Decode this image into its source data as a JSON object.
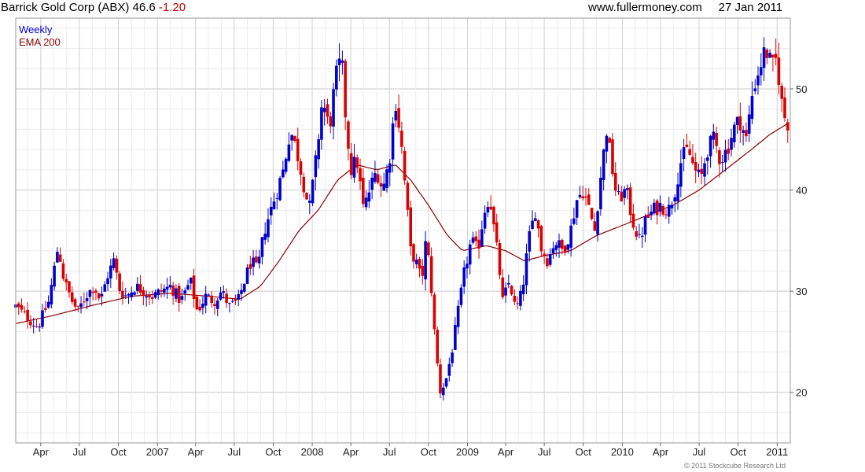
{
  "header": {
    "title": "Barrick Gold Corp (ABX)",
    "last": "46.6",
    "change": "-1.20",
    "site": "www.fullermoney.com",
    "date": "27 Jan 2011"
  },
  "colors": {
    "up": "#0000cc",
    "down": "#dd0000",
    "ema": "#8b0000",
    "grid": "#dedede",
    "border": "#999999"
  },
  "copyright": "© 2011 Stockcube Research Ltd",
  "chart_data": {
    "type": "candlestick",
    "title": "Barrick Gold Corp (ABX) 46.6 -1.20",
    "interval": "Weekly",
    "ylim": [
      15,
      57
    ],
    "yticks": [
      20,
      30,
      40,
      50
    ],
    "grid": true,
    "legend_position": "top-left",
    "legend": [
      "Weekly",
      "EMA 200"
    ],
    "xticks": [
      {
        "label": "Apr",
        "date": "2006-04-01"
      },
      {
        "label": "Jul",
        "date": "2006-07-01"
      },
      {
        "label": "Oct",
        "date": "2006-10-01"
      },
      {
        "label": "2007",
        "date": "2007-01-01"
      },
      {
        "label": "Apr",
        "date": "2007-04-01"
      },
      {
        "label": "Jul",
        "date": "2007-07-01"
      },
      {
        "label": "Oct",
        "date": "2007-10-01"
      },
      {
        "label": "2008",
        "date": "2008-01-01"
      },
      {
        "label": "Apr",
        "date": "2008-04-01"
      },
      {
        "label": "Jul",
        "date": "2008-07-01"
      },
      {
        "label": "Oct",
        "date": "2008-10-01"
      },
      {
        "label": "2009",
        "date": "2009-01-01"
      },
      {
        "label": "Apr",
        "date": "2009-04-01"
      },
      {
        "label": "Jul",
        "date": "2009-07-01"
      },
      {
        "label": "Oct",
        "date": "2009-10-01"
      },
      {
        "label": "2010",
        "date": "2010-01-01"
      },
      {
        "label": "Apr",
        "date": "2010-04-01"
      },
      {
        "label": "Jul",
        "date": "2010-07-01"
      },
      {
        "label": "Oct",
        "date": "2010-10-01"
      },
      {
        "label": "2011",
        "date": "2011-01-01"
      }
    ],
    "date_range": [
      "2006-02-01",
      "2011-02-01"
    ],
    "close_anchors": [
      [
        "2006-02-01",
        28.5
      ],
      [
        "2006-03-10",
        27.0
      ],
      [
        "2006-03-25",
        26.5
      ],
      [
        "2006-04-20",
        29.0
      ],
      [
        "2006-05-12",
        34.5
      ],
      [
        "2006-05-26",
        31.0
      ],
      [
        "2006-06-14",
        29.0
      ],
      [
        "2006-06-28",
        28.0
      ],
      [
        "2006-07-15",
        29.5
      ],
      [
        "2006-08-05",
        30.5
      ],
      [
        "2006-08-20",
        29.0
      ],
      [
        "2006-09-05",
        31.5
      ],
      [
        "2006-09-20",
        33.0
      ],
      [
        "2006-10-05",
        30.0
      ],
      [
        "2006-10-20",
        29.5
      ],
      [
        "2006-11-10",
        30.5
      ],
      [
        "2006-12-01",
        30.0
      ],
      [
        "2006-12-20",
        29.5
      ],
      [
        "2007-01-10",
        30.0
      ],
      [
        "2007-02-01",
        30.5
      ],
      [
        "2007-02-25",
        29.0
      ],
      [
        "2007-03-20",
        31.0
      ],
      [
        "2007-04-05",
        28.0
      ],
      [
        "2007-04-25",
        29.5
      ],
      [
        "2007-05-15",
        29.0
      ],
      [
        "2007-06-01",
        30.0
      ],
      [
        "2007-06-20",
        28.5
      ],
      [
        "2007-07-10",
        29.0
      ],
      [
        "2007-07-25",
        31.0
      ],
      [
        "2007-08-10",
        33.0
      ],
      [
        "2007-08-25",
        32.0
      ],
      [
        "2007-09-10",
        36.0
      ],
      [
        "2007-09-25",
        38.0
      ],
      [
        "2007-10-10",
        40.0
      ],
      [
        "2007-10-25",
        42.0
      ],
      [
        "2007-11-10",
        46.0
      ],
      [
        "2007-11-25",
        44.0
      ],
      [
        "2007-12-10",
        41.0
      ],
      [
        "2007-12-25",
        38.0
      ],
      [
        "2008-01-10",
        43.0
      ],
      [
        "2008-01-25",
        49.0
      ],
      [
        "2008-02-10",
        46.0
      ],
      [
        "2008-02-25",
        51.0
      ],
      [
        "2008-03-10",
        53.0
      ],
      [
        "2008-03-20",
        47.0
      ],
      [
        "2008-04-01",
        42.0
      ],
      [
        "2008-04-15",
        43.0
      ],
      [
        "2008-05-01",
        38.0
      ],
      [
        "2008-05-15",
        40.0
      ],
      [
        "2008-06-01",
        42.0
      ],
      [
        "2008-06-15",
        40.0
      ],
      [
        "2008-07-01",
        43.0
      ],
      [
        "2008-07-15",
        49.0
      ],
      [
        "2008-07-28",
        45.0
      ],
      [
        "2008-08-10",
        39.0
      ],
      [
        "2008-08-20",
        34.0
      ],
      [
        "2008-09-01",
        33.0
      ],
      [
        "2008-09-15",
        31.0
      ],
      [
        "2008-09-25",
        35.0
      ],
      [
        "2008-10-05",
        32.0
      ],
      [
        "2008-10-15",
        26.0
      ],
      [
        "2008-10-28",
        20.0
      ],
      [
        "2008-11-10",
        21.0
      ],
      [
        "2008-11-25",
        24.0
      ],
      [
        "2008-12-10",
        28.0
      ],
      [
        "2008-12-25",
        32.0
      ],
      [
        "2009-01-10",
        35.0
      ],
      [
        "2009-01-25",
        34.0
      ],
      [
        "2009-02-10",
        38.0
      ],
      [
        "2009-02-22",
        39.5
      ],
      [
        "2009-03-05",
        36.0
      ],
      [
        "2009-03-15",
        33.0
      ],
      [
        "2009-03-25",
        29.0
      ],
      [
        "2009-04-10",
        31.0
      ],
      [
        "2009-04-25",
        28.0
      ],
      [
        "2009-05-10",
        30.0
      ],
      [
        "2009-05-25",
        35.0
      ],
      [
        "2009-06-10",
        38.0
      ],
      [
        "2009-06-25",
        34.0
      ],
      [
        "2009-07-10",
        33.0
      ],
      [
        "2009-07-25",
        35.0
      ],
      [
        "2009-08-15",
        34.0
      ],
      [
        "2009-09-01",
        36.0
      ],
      [
        "2009-09-15",
        39.0
      ],
      [
        "2009-10-01",
        40.0
      ],
      [
        "2009-10-15",
        38.0
      ],
      [
        "2009-10-28",
        36.0
      ],
      [
        "2009-11-10",
        41.0
      ],
      [
        "2009-11-25",
        46.0
      ],
      [
        "2009-12-05",
        43.0
      ],
      [
        "2009-12-20",
        39.0
      ],
      [
        "2010-01-10",
        40.0
      ],
      [
        "2010-01-25",
        37.0
      ],
      [
        "2010-02-10",
        35.0
      ],
      [
        "2010-02-25",
        37.0
      ],
      [
        "2010-03-15",
        38.0
      ],
      [
        "2010-04-01",
        38.5
      ],
      [
        "2010-04-20",
        38.0
      ],
      [
        "2010-05-05",
        40.0
      ],
      [
        "2010-05-20",
        43.0
      ],
      [
        "2010-06-05",
        44.0
      ],
      [
        "2010-06-20",
        42.0
      ],
      [
        "2010-07-05",
        41.0
      ],
      [
        "2010-07-20",
        44.0
      ],
      [
        "2010-08-05",
        45.0
      ],
      [
        "2010-08-20",
        43.0
      ],
      [
        "2010-09-05",
        44.0
      ],
      [
        "2010-09-20",
        46.0
      ],
      [
        "2010-10-05",
        47.0
      ],
      [
        "2010-10-20",
        45.0
      ],
      [
        "2010-11-05",
        50.0
      ],
      [
        "2010-11-20",
        52.0
      ],
      [
        "2010-12-05",
        54.0
      ],
      [
        "2010-12-20",
        52.0
      ],
      [
        "2011-01-01",
        53.0
      ],
      [
        "2011-01-10",
        49.0
      ],
      [
        "2011-01-20",
        47.0
      ],
      [
        "2011-01-27",
        46.6
      ]
    ],
    "ema_anchors": [
      [
        "2006-02-01",
        26.8
      ],
      [
        "2006-05-01",
        27.6
      ],
      [
        "2006-08-01",
        28.6
      ],
      [
        "2006-11-01",
        29.5
      ],
      [
        "2007-02-01",
        29.8
      ],
      [
        "2007-05-01",
        29.5
      ],
      [
        "2007-07-15",
        29.2
      ],
      [
        "2007-09-01",
        30.5
      ],
      [
        "2007-10-15",
        33.0
      ],
      [
        "2007-12-01",
        36.0
      ],
      [
        "2008-01-15",
        38.0
      ],
      [
        "2008-03-01",
        41.0
      ],
      [
        "2008-04-15",
        42.5
      ],
      [
        "2008-06-01",
        42.0
      ],
      [
        "2008-07-15",
        42.5
      ],
      [
        "2008-08-20",
        41.0
      ],
      [
        "2008-10-01",
        38.5
      ],
      [
        "2008-11-15",
        35.5
      ],
      [
        "2008-12-20",
        34.0
      ],
      [
        "2009-02-15",
        34.5
      ],
      [
        "2009-04-01",
        34.0
      ],
      [
        "2009-05-15",
        33.0
      ],
      [
        "2009-07-01",
        33.5
      ],
      [
        "2009-09-01",
        34.0
      ],
      [
        "2009-11-01",
        35.5
      ],
      [
        "2010-01-01",
        36.5
      ],
      [
        "2010-03-01",
        37.5
      ],
      [
        "2010-05-01",
        38.5
      ],
      [
        "2010-07-01",
        40.0
      ],
      [
        "2010-09-01",
        42.0
      ],
      [
        "2010-11-01",
        44.0
      ],
      [
        "2010-12-15",
        45.5
      ],
      [
        "2011-01-27",
        46.6
      ]
    ]
  }
}
